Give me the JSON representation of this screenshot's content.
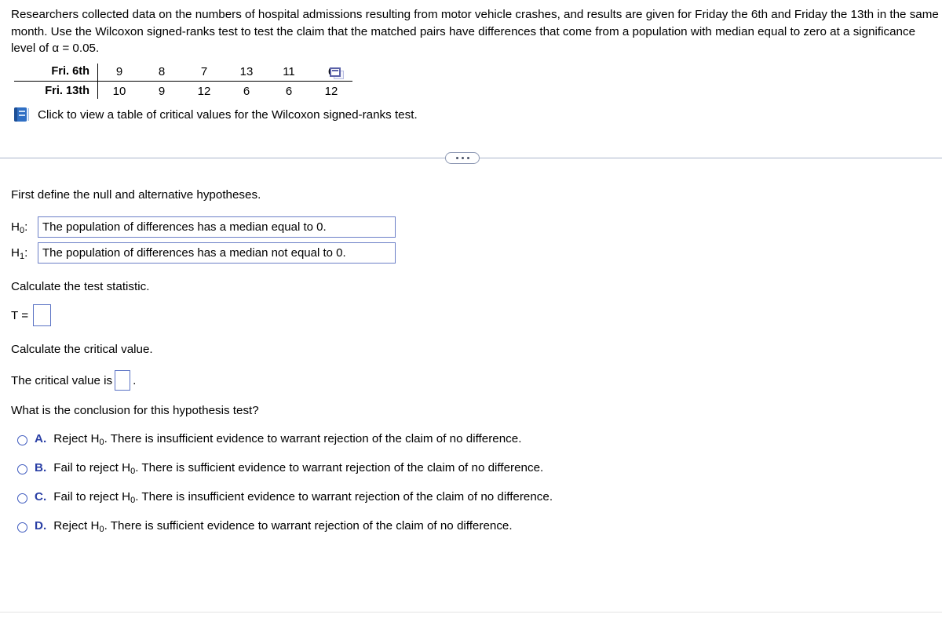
{
  "problem": {
    "statement": "Researchers collected data on the numbers of hospital admissions resulting from motor vehicle crashes, and results are given for Friday the 6th and Friday the 13th in the same month. Use the Wilcoxon signed-ranks test to test the claim that the matched pairs have differences that come from a population with median equal to zero at a significance level of α = 0.05."
  },
  "data_table": {
    "rows": [
      {
        "label": "Fri. 6th",
        "values": [
          "9",
          "8",
          "7",
          "13",
          "11",
          "6"
        ]
      },
      {
        "label": "Fri. 13th",
        "values": [
          "10",
          "9",
          "12",
          "6",
          "6",
          "12"
        ]
      }
    ],
    "copy_icon": "copy-to-spreadsheet-icon"
  },
  "popup_link": {
    "icon": "book-icon",
    "text": "Click to view a table of critical values for the Wilcoxon signed-ranks test."
  },
  "divider": {
    "dots_label": "more-options-dots"
  },
  "body": {
    "first_define": "First define the null and alternative hypotheses.",
    "hypotheses": [
      {
        "label_base": "H",
        "label_sub": "0",
        "label_colon": ":",
        "value": "The population of differences has a median equal to 0."
      },
      {
        "label_base": "H",
        "label_sub": "1",
        "label_colon": ":",
        "value": "The population of differences has a median not equal to 0."
      }
    ],
    "calc_test_statistic": "Calculate the test statistic.",
    "test_statistic": {
      "label": "T =",
      "value": "",
      "placeholder": ""
    },
    "calc_critical_value": "Calculate the critical value.",
    "critical_value": {
      "prefix": "The critical value is",
      "value": "",
      "suffix": "."
    },
    "conclusion_question": "What is the conclusion for this hypothesis test?",
    "choices": [
      {
        "letter": "A.",
        "pre": "Reject H",
        "sub": "0",
        "post": ". There is insufficient evidence to warrant rejection of the claim of no difference."
      },
      {
        "letter": "B.",
        "pre": "Fail to reject H",
        "sub": "0",
        "post": ". There is sufficient evidence to warrant rejection of the claim of no difference."
      },
      {
        "letter": "C.",
        "pre": "Fail to reject H",
        "sub": "0",
        "post": ". There is insufficient evidence to warrant rejection of the claim of no difference."
      },
      {
        "letter": "D.",
        "pre": "Reject H",
        "sub": "0",
        "post": ". There is sufficient evidence to warrant rejection of the claim of no difference."
      }
    ]
  },
  "colors": {
    "accent_blue": "#2a3fa5",
    "input_border": "#5a72c4",
    "divider": "#aab4cb",
    "book_blue": "#2f6fc4"
  }
}
